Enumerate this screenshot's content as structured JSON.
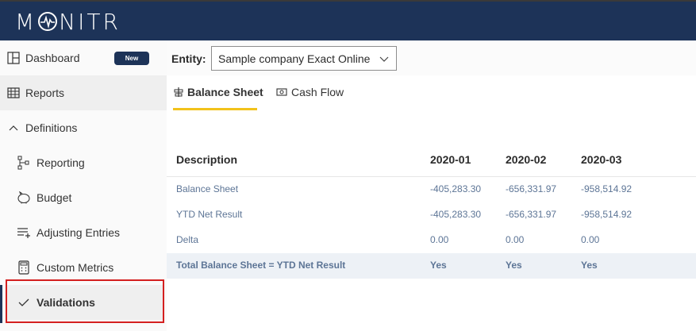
{
  "app": {
    "logo_text": "MONITR",
    "brand_color": "#1d3358",
    "accent_color": "#f2c21b"
  },
  "sidebar": {
    "items": [
      {
        "label": "Dashboard",
        "icon": "dashboard-icon",
        "badge": "New"
      },
      {
        "label": "Reports",
        "icon": "table-icon"
      },
      {
        "label": "Definitions",
        "icon": "chevron-up-icon"
      },
      {
        "label": "Reporting",
        "icon": "hierarchy-icon"
      },
      {
        "label": "Budget",
        "icon": "piggy-bank-icon"
      },
      {
        "label": "Adjusting Entries",
        "icon": "list-add-icon"
      },
      {
        "label": "Custom Metrics",
        "icon": "calculator-icon"
      },
      {
        "label": "Validations",
        "icon": "checkmark-icon"
      }
    ]
  },
  "entity": {
    "label": "Entity:",
    "selected": "Sample company Exact Online"
  },
  "tabs": [
    {
      "label": "Balance Sheet",
      "icon": "balance-icon",
      "active": true
    },
    {
      "label": "Cash Flow",
      "icon": "money-icon",
      "active": false
    }
  ],
  "table": {
    "headers": [
      "Description",
      "2020-01",
      "2020-02",
      "2020-03"
    ],
    "rows": [
      [
        "Balance Sheet",
        "-405,283.30",
        "-656,331.97",
        "-958,514.92"
      ],
      [
        "YTD Net Result",
        "-405,283.30",
        "-656,331.97",
        "-958,514.92"
      ],
      [
        "Delta",
        "0.00",
        "0.00",
        "0.00"
      ],
      [
        "Total Balance Sheet = YTD Net Result",
        "Yes",
        "Yes",
        "Yes"
      ]
    ]
  }
}
